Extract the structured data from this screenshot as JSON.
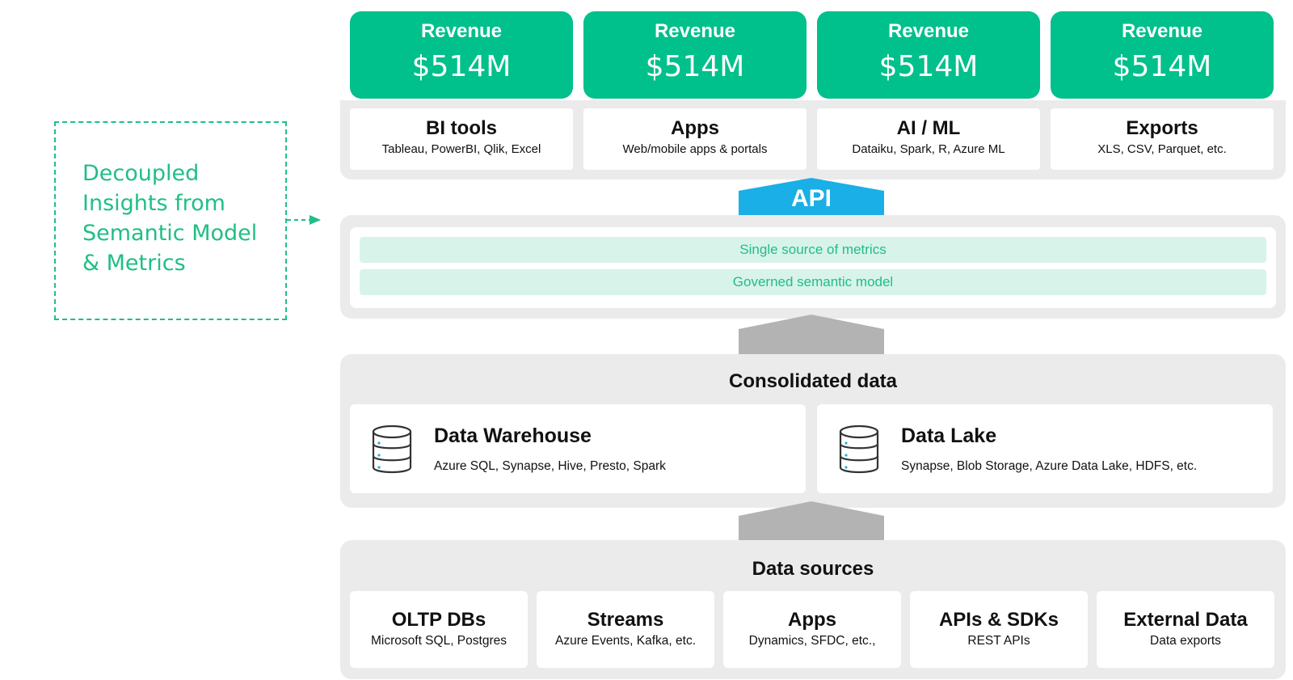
{
  "callout": {
    "lines": [
      "Decoupled",
      "Insights from",
      "Semantic Model",
      "& Metrics"
    ],
    "color": "#1fbf85"
  },
  "revenue_cards": [
    {
      "title": "Revenue",
      "value": "$514M"
    },
    {
      "title": "Revenue",
      "value": "$514M"
    },
    {
      "title": "Revenue",
      "value": "$514M"
    },
    {
      "title": "Revenue",
      "value": "$514M"
    }
  ],
  "consumers": [
    {
      "title": "BI tools",
      "subtitle": "Tableau, PowerBI, Qlik, Excel"
    },
    {
      "title": "Apps",
      "subtitle": "Web/mobile apps & portals"
    },
    {
      "title": "AI / ML",
      "subtitle": "Dataiku, Spark, R, Azure ML"
    },
    {
      "title": "Exports",
      "subtitle": "XLS, CSV, Parquet, etc."
    }
  ],
  "api": {
    "label": "API",
    "color": "#1aafe6"
  },
  "semantic_layer": {
    "bars": [
      "Single source of metrics",
      "Governed semantic model"
    ]
  },
  "consolidated": {
    "title": "Consolidated data",
    "stores": [
      {
        "title": "Data Warehouse",
        "subtitle": "Azure SQL, Synapse, Hive, Presto, Spark",
        "icon": "database-icon"
      },
      {
        "title": "Data Lake",
        "subtitle": "Synapse, Blob Storage, Azure Data Lake, HDFS,  etc.",
        "icon": "database-icon"
      }
    ]
  },
  "data_sources": {
    "title": "Data sources",
    "items": [
      {
        "title": "OLTP DBs",
        "subtitle": "Microsoft SQL, Postgres"
      },
      {
        "title": "Streams",
        "subtitle": "Azure Events, Kafka, etc."
      },
      {
        "title": "Apps",
        "subtitle": "Dynamics, SFDC, etc.,"
      },
      {
        "title": "APIs & SDKs",
        "subtitle": "REST APIs"
      },
      {
        "title": "External Data",
        "subtitle": "Data exports"
      }
    ]
  },
  "colors": {
    "accent_green": "#00c08b",
    "panel_gray": "#ebebeb",
    "arrow_gray": "#b3b3b3",
    "api_blue": "#1aafe6"
  }
}
